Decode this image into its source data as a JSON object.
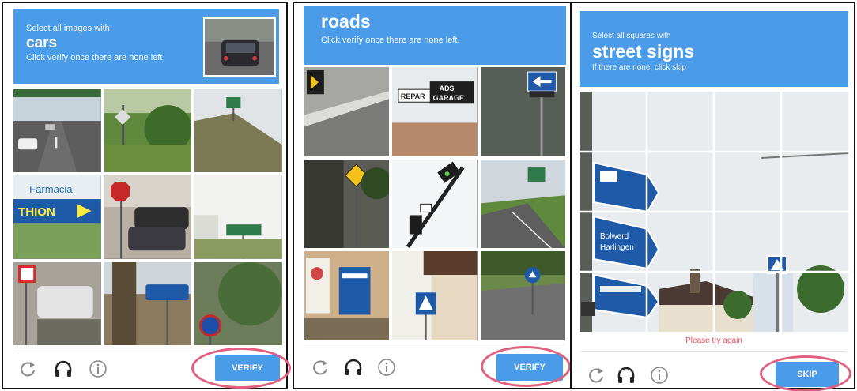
{
  "panel1": {
    "header": {
      "line1": "Select all images with",
      "target": "cars",
      "line3": "Click verify once there are none left"
    },
    "verify_label": "VERIFY"
  },
  "panel2": {
    "header": {
      "target": "roads",
      "line2": "Click verify once there are none left."
    },
    "verify_label": "VERIFY"
  },
  "panel3": {
    "header": {
      "line1": "Select all squares with",
      "target": "street signs",
      "line3": "If there are none, click skip"
    },
    "error_text": "Please try again",
    "skip_label": "SKIP"
  },
  "tile_signs": {
    "farmacia": "Farmacia",
    "thion": "THION",
    "ads": "ADS",
    "garage": "GARAGE",
    "repar": "REPAR",
    "bolwerd": "Bolwerd",
    "harlingen": "Harlingen"
  },
  "colors": {
    "header_blue": "#4a9be8",
    "annotation_pink": "#e0607e",
    "error_red": "#e24b5a"
  },
  "icons": [
    "reload-icon",
    "headphones-icon",
    "info-icon"
  ]
}
